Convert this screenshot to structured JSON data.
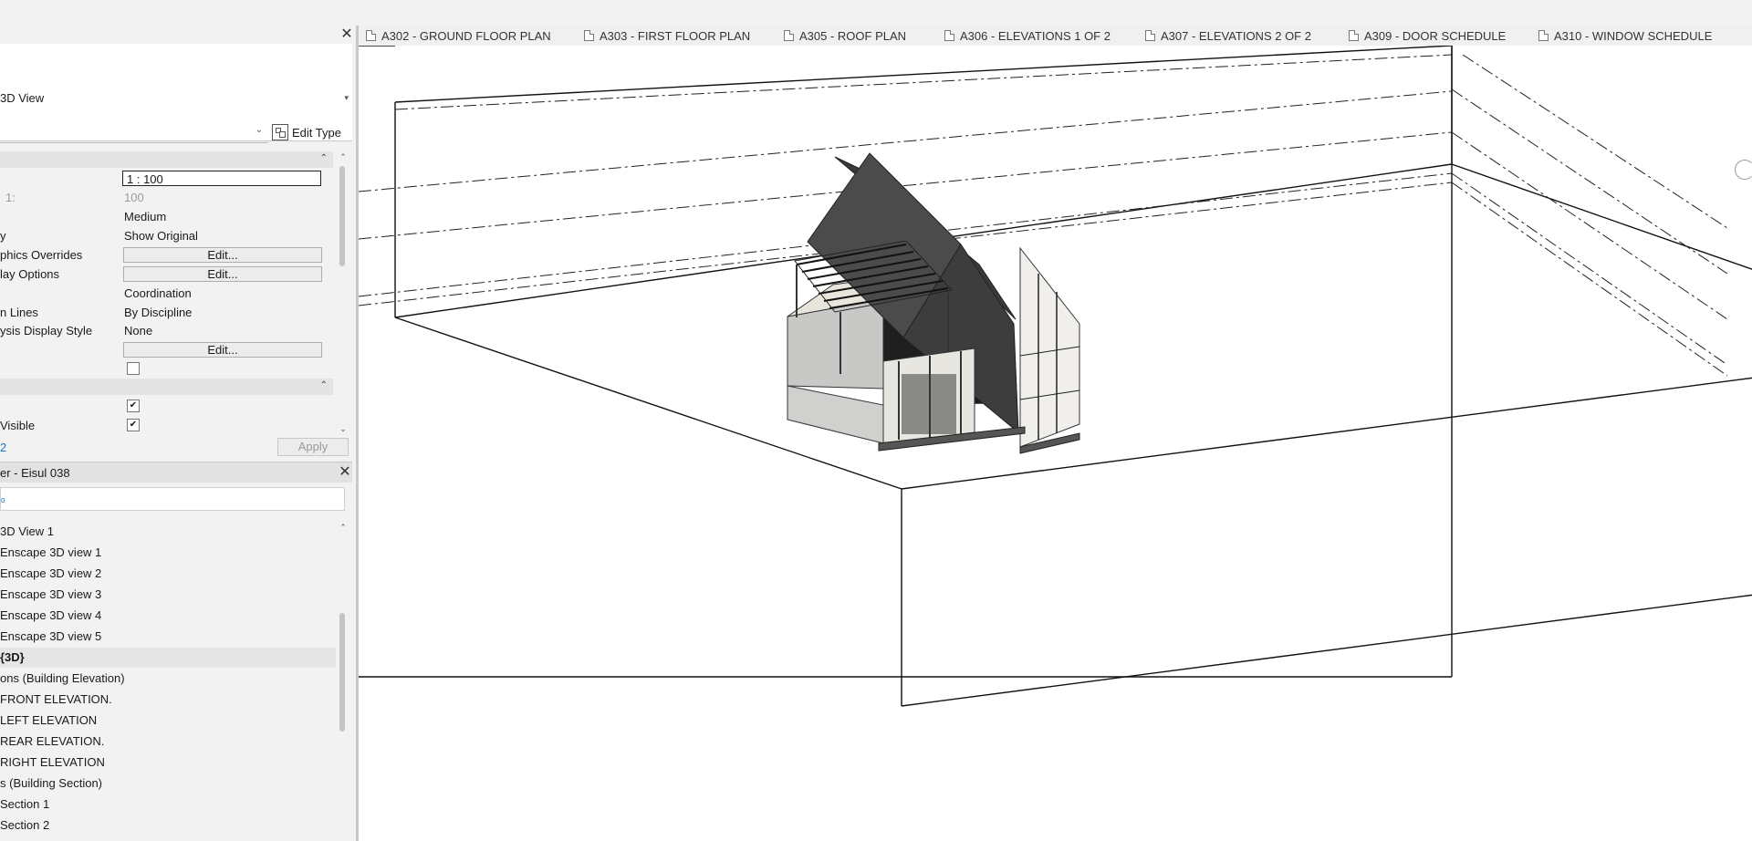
{
  "properties_panel": {
    "type_selector": {
      "label": "3D View"
    },
    "filter": {
      "value": ""
    },
    "edit_type_label": "Edit Type",
    "rows": [
      {
        "name": "",
        "value": "1 : 100",
        "kind": "input"
      },
      {
        "name": "1:",
        "value": "100",
        "kind": "dim"
      },
      {
        "name": "",
        "value": "Medium",
        "kind": "text"
      },
      {
        "name": "y",
        "value": "Show Original",
        "kind": "text"
      },
      {
        "name": "phics Overrides",
        "value": "Edit...",
        "kind": "button"
      },
      {
        "name": "lay Options",
        "value": "Edit...",
        "kind": "button"
      },
      {
        "name": "",
        "value": "Coordination",
        "kind": "text"
      },
      {
        "name": "n Lines",
        "value": "By Discipline",
        "kind": "text"
      },
      {
        "name": "ysis Display Style",
        "value": "None",
        "kind": "text"
      },
      {
        "name": "",
        "value": "Edit...",
        "kind": "button"
      },
      {
        "name": "",
        "value": "",
        "kind": "checkbox",
        "checked": false
      },
      {
        "name": "",
        "value": "",
        "kind": "checkbox",
        "checked": true
      },
      {
        "name": "Visible",
        "value": "",
        "kind": "checkbox",
        "checked": true
      }
    ],
    "help_link": "2",
    "apply_label": "Apply"
  },
  "project_browser": {
    "title": "er - Eisul 038",
    "search_placeholder": "",
    "items": [
      {
        "label": "3D View 1",
        "selected": false
      },
      {
        "label": "Enscape 3D view 1",
        "selected": false
      },
      {
        "label": "Enscape 3D view 2",
        "selected": false
      },
      {
        "label": "Enscape 3D view 3",
        "selected": false
      },
      {
        "label": "Enscape 3D view 4",
        "selected": false
      },
      {
        "label": "Enscape 3D view 5",
        "selected": false
      },
      {
        "label": "{3D}",
        "selected": true
      },
      {
        "label": "ons (Building Elevation)",
        "selected": false
      },
      {
        "label": "FRONT ELEVATION.",
        "selected": false
      },
      {
        "label": "LEFT ELEVATION",
        "selected": false
      },
      {
        "label": "REAR ELEVATION.",
        "selected": false
      },
      {
        "label": "RIGHT ELEVATION",
        "selected": false
      },
      {
        "label": "s (Building Section)",
        "selected": false
      },
      {
        "label": "Section 1",
        "selected": false
      },
      {
        "label": "Section 2",
        "selected": false
      }
    ]
  },
  "view_tabs": [
    {
      "label": "A302 - GROUND FLOOR PLAN"
    },
    {
      "label": "A303 - FIRST FLOOR PLAN"
    },
    {
      "label": "A305 - ROOF PLAN"
    },
    {
      "label": "A306 - ELEVATIONS 1 OF 2"
    },
    {
      "label": "A307 - ELEVATIONS 2 OF 2"
    },
    {
      "label": "A309 - DOOR SCHEDULE"
    },
    {
      "label": "A310 - WINDOW SCHEDULE"
    }
  ],
  "icons": {
    "close": "close-icon",
    "collapse": "chevron-up-double-icon",
    "dropdown": "chevron-down-icon",
    "document": "sheet-document-icon",
    "edit_type": "edit-type-icon",
    "search": "search-icon",
    "navigation": "navigation-wheel-icon"
  }
}
